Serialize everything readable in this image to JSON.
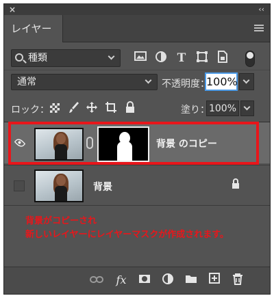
{
  "titlebar": {
    "close_glyph": "×",
    "collapse_glyph": "‹‹"
  },
  "tab": {
    "label": "レイヤー"
  },
  "filter": {
    "kind_label": "種類",
    "icons": [
      "image-filter-icon",
      "adjustment-filter-icon",
      "type-filter-icon",
      "shape-filter-icon",
      "smart-object-filter-icon"
    ]
  },
  "blend": {
    "mode": "通常",
    "opacity_label": "不透明度：",
    "opacity_value": "100%"
  },
  "lock": {
    "label": "ロック：",
    "fill_label": "塗り：",
    "fill_value": "100%"
  },
  "layers": [
    {
      "name": "背景 のコピー",
      "visible": true,
      "has_mask": true,
      "selected": true
    },
    {
      "name": "背景",
      "visible": false,
      "locked": true,
      "selected": false
    }
  ],
  "annotation": {
    "line1": "背景がコピーされ",
    "line2": "新しいレイヤーにレイヤーマスクが作成されます。",
    "color": "#e8161b"
  },
  "bottom_icons": [
    "link-layers-icon",
    "fx-icon",
    "add-mask-icon",
    "adjustment-layer-icon",
    "group-folder-icon",
    "new-layer-icon",
    "trash-icon"
  ]
}
